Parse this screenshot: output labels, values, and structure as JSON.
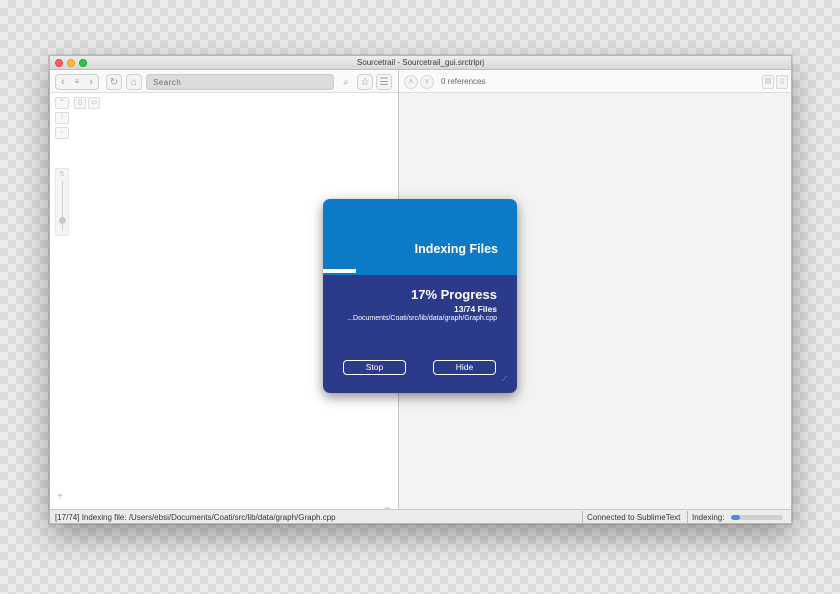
{
  "window": {
    "title": "Sourcetrail - Sourcetrail_gui.srctrlprj"
  },
  "toolbar": {
    "back_icon": "chevron-left-icon",
    "menu_icon": "list-icon",
    "forward_icon": "chevron-right-icon",
    "refresh_icon": "refresh-icon",
    "home_icon": "home-icon",
    "search_placeholder": "Search",
    "search_value": "",
    "search_icon": "search-icon",
    "bookmark_icon": "star-icon",
    "bookmarks_list_icon": "bookmarks-list-icon"
  },
  "code_view": {
    "references": "0 references"
  },
  "graph_view": {
    "zoom_plus": "+",
    "zoom_minus": "−",
    "help": "?"
  },
  "dialog": {
    "title": "Indexing Files",
    "progress_percent": 17,
    "progress_label": "17% Progress",
    "files": "13/74 Files",
    "current_file": "...Documents/Coati/src/lib/data/graph/Graph.cpp",
    "stop_label": "Stop",
    "hide_label": "Hide",
    "accent_top": "#0d7ac8",
    "accent_bottom": "#2c3a8a"
  },
  "statusbar": {
    "message": "[17/74] Indexing file: /Users/ebsi/Documents/Coati/src/lib/data/graph/Graph.cpp",
    "connection": "Connected to SublimeText",
    "indexing_label": "Indexing:",
    "indexing_percent": 17
  }
}
